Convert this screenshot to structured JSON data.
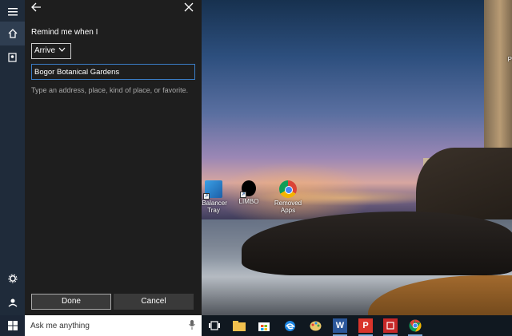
{
  "panel": {
    "heading": "Remind me when I",
    "trigger_selected": "Arrive",
    "place_value": "Bogor Botanical Gardens",
    "hint": "Type an address, place, kind of place, or favorite.",
    "done_label": "Done",
    "cancel_label": "Cancel"
  },
  "desktop": {
    "icons": [
      {
        "label_line1": "tBalancer",
        "label_line2": "Tray"
      },
      {
        "label_line1": "LIMBO",
        "label_line2": ""
      },
      {
        "label_line1": "Removed",
        "label_line2": "Apps"
      }
    ],
    "edge_label": "P"
  },
  "taskbar": {
    "search_placeholder": "Ask me anything",
    "word_label": "W",
    "pdf_label": "P"
  },
  "colors": {
    "panel_bg": "#1e1e1e",
    "rail_bg": "#1f2b3a",
    "accent": "#3b7ec7",
    "taskbar_bg": "#101820"
  },
  "icons": [
    "hamburger-menu-icon",
    "home-icon",
    "notebook-icon",
    "settings-icon",
    "feedback-icon",
    "back-arrow-icon",
    "close-icon",
    "chevron-down-icon",
    "microphone-icon",
    "windows-logo-icon",
    "task-view-icon",
    "file-explorer-icon",
    "store-icon",
    "edge-icon",
    "paint-icon",
    "word-icon",
    "pdf-icon",
    "photo-icon",
    "chrome-icon"
  ]
}
